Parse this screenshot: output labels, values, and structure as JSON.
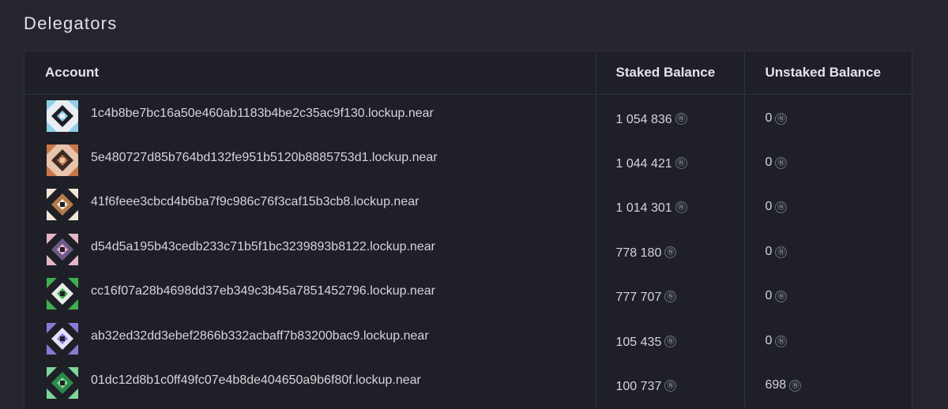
{
  "section": {
    "title": "Delegators"
  },
  "table": {
    "headers": {
      "account": "Account",
      "staked": "Staked Balance",
      "unstaked": "Unstaked Balance"
    },
    "currency_symbol": "Ⓝ",
    "rows": [
      {
        "account": "1c4b8be7bc16a50e460ab1183b4be2c35ac9f130.lockup.near",
        "staked": "1 054 836",
        "unstaked": "0",
        "avatar_colors": [
          "#8fd0ea",
          "#1f2027",
          "#e9eef2"
        ]
      },
      {
        "account": "5e480727d85b764bd132fe951b5120b8885753d1.lockup.near",
        "staked": "1 044 421",
        "unstaked": "0",
        "avatar_colors": [
          "#c9764a",
          "#3a2a26",
          "#e8c4ad"
        ]
      },
      {
        "account": "41f6feee3cbcd4b6ba7f9c986c76f3caf15b3cb8.lockup.near",
        "staked": "1 014 301",
        "unstaked": "0",
        "avatar_colors": [
          "#f2e6d8",
          "#b57a4b",
          "#1f2027"
        ]
      },
      {
        "account": "d54d5a195b43cedb233c71b5f1bc3239893b8122.lockup.near",
        "staked": "778 180",
        "unstaked": "0",
        "avatar_colors": [
          "#e8b5c8",
          "#6d5a8c",
          "#1f2027"
        ]
      },
      {
        "account": "cc16f07a28b4698dd37eb349c3b45a7851452796.lockup.near",
        "staked": "777 707",
        "unstaked": "0",
        "avatar_colors": [
          "#3fae4f",
          "#e8ece6",
          "#1f2027"
        ]
      },
      {
        "account": "ab32ed32dd3ebef2866b332acbaff7b83200bac9.lockup.near",
        "staked": "105 435",
        "unstaked": "0",
        "avatar_colors": [
          "#8c79d6",
          "#e6e1f7",
          "#1f2027"
        ]
      },
      {
        "account": "01dc12d8b1c0ff49fc07e4b8de404650a9b6f80f.lockup.near",
        "staked": "100 737",
        "unstaked": "698",
        "avatar_colors": [
          "#7fd59a",
          "#2c8a49",
          "#1f2027"
        ]
      }
    ]
  }
}
